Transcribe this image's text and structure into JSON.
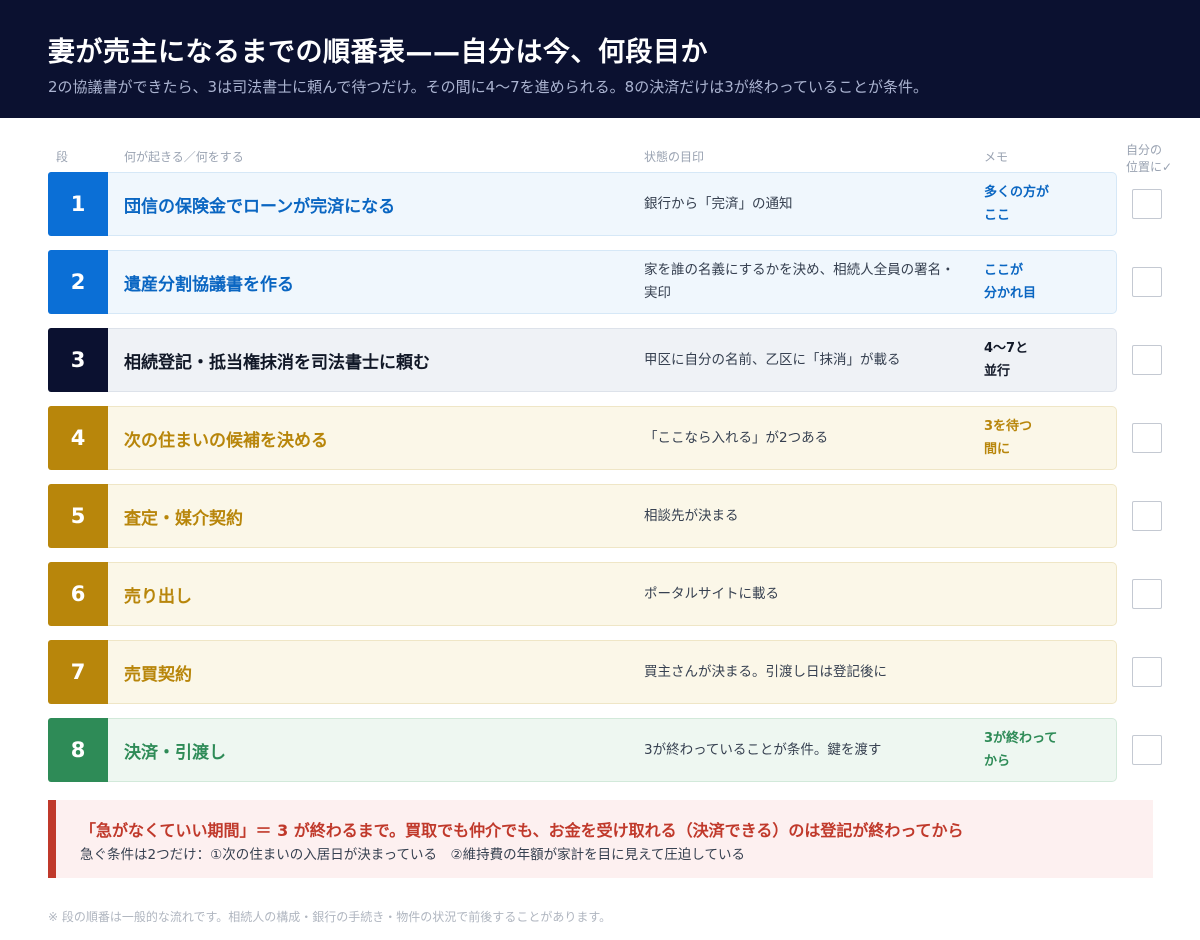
{
  "header": {
    "title": "妻が売主になるまでの順番表——自分は今、何段目か",
    "subtitle": "2の協議書ができたら、3は司法書士に頼んで待つだけ。その間に4〜7を進められる。8の決済だけは3が終わっていることが条件。"
  },
  "columns": {
    "stage": "段",
    "event": "何が起きる／何をする",
    "status": "状態の目印",
    "memo": "メモ",
    "check_line1": "自分の",
    "check_line2": "位置に✓"
  },
  "rows": [
    {
      "num": "1",
      "step": "団信の保険金でローンが完済になる",
      "status": "銀行から「完済」の通知",
      "memo_line1": "多くの方が",
      "memo_line2": "ここ"
    },
    {
      "num": "2",
      "step": "遺産分割協議書を作る",
      "status": "家を誰の名義にするかを決め、相続人全員の署名・実印",
      "memo_line1": "ここが",
      "memo_line2": "分かれ目"
    },
    {
      "num": "3",
      "step": "相続登記・抵当権抹消を司法書士に頼む",
      "status": "甲区に自分の名前、乙区に「抹消」が載る",
      "memo_line1": "4〜7と",
      "memo_line2": "並行"
    },
    {
      "num": "4",
      "step": "次の住まいの候補を決める",
      "status": "「ここなら入れる」が2つある",
      "memo_line1": "3を待つ",
      "memo_line2": "間に"
    },
    {
      "num": "5",
      "step": "査定・媒介契約",
      "status": "相談先が決まる",
      "memo_line1": "",
      "memo_line2": ""
    },
    {
      "num": "6",
      "step": "売り出し",
      "status": "ポータルサイトに載る",
      "memo_line1": "",
      "memo_line2": ""
    },
    {
      "num": "7",
      "step": "売買契約",
      "status": "買主さんが決まる。引渡し日は登記後に",
      "memo_line1": "",
      "memo_line2": ""
    },
    {
      "num": "8",
      "step": "決済・引渡し",
      "status": "3が終わっていることが条件。鍵を渡す",
      "memo_line1": "3が終わって",
      "memo_line2": "から"
    }
  ],
  "callout": {
    "main": "「急がなくていい期間」＝ 3 が終わるまで。買取でも仲介でも、お金を受け取れる（決済できる）のは登記が終わってから",
    "sub": "急ぐ条件は2つだけ：①次の住まいの入居日が決まっている　②維持費の年額が家計を目に見えて圧迫している"
  },
  "footnote": "※ 段の順番は一般的な流れです。相続人の構成・銀行の手続き・物件の状況で前後することがあります。",
  "colors": {
    "header_bg": "#0b1130",
    "blue": "#0b6fd6",
    "navy": "#0b1130",
    "gold": "#b8860b",
    "green": "#2e8b57",
    "alert": "#c0392b"
  }
}
